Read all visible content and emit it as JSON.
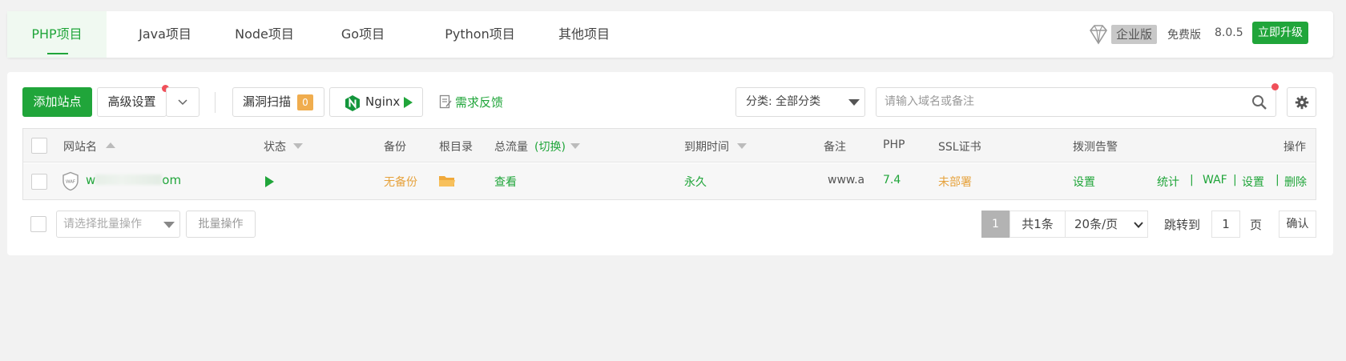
{
  "tabs": [
    {
      "label": "PHP项目",
      "active": true
    },
    {
      "label": "Java项目"
    },
    {
      "label": "Node项目"
    },
    {
      "label": "Go项目"
    },
    {
      "label": "Python项目"
    },
    {
      "label": "其他项目"
    }
  ],
  "version": {
    "enterprise_label": "企业版",
    "free_label": "免费版",
    "number": "8.0.5",
    "upgrade_label": "立即升级"
  },
  "toolbar": {
    "add_site": "添加站点",
    "advanced": "高级设置",
    "vuln_scan": "漏洞扫描",
    "vuln_count": "0",
    "nginx": "Nginx",
    "feedback": "需求反馈",
    "category": "分类: 全部分类",
    "search_placeholder": "请输入域名或备注"
  },
  "table": {
    "headers": {
      "site_name": "网站名",
      "status": "状态",
      "backup": "备份",
      "root": "根目录",
      "traffic": "总流量",
      "traffic_toggle": "(切换)",
      "expire": "到期时间",
      "remark": "备注",
      "php": "PHP",
      "ssl": "SSL证书",
      "monitor": "拨测告警",
      "ops": "操作"
    },
    "rows": [
      {
        "waf_icon_text": "WAF",
        "site_prefix": "w",
        "site_suffix": "om",
        "backup": "无备份",
        "traffic": "查看",
        "expire": "永久",
        "remark": "www.a",
        "php": "7.4",
        "ssl": "未部署",
        "monitor": "设置",
        "ops": [
          "统计",
          "WAF",
          "设置",
          "删除"
        ],
        "op_sep": "|"
      }
    ]
  },
  "footer": {
    "batch_placeholder": "请选择批量操作",
    "batch_btn": "批量操作",
    "current_page": "1",
    "total": "共1条",
    "per_page": "20条/页",
    "jump_label": "跳转到",
    "jump_value": "1",
    "page_unit": "页",
    "confirm": "确认"
  },
  "colors": {
    "accent": "#20a53a",
    "warning": "#e6a23c",
    "dot": "#f0505a"
  }
}
